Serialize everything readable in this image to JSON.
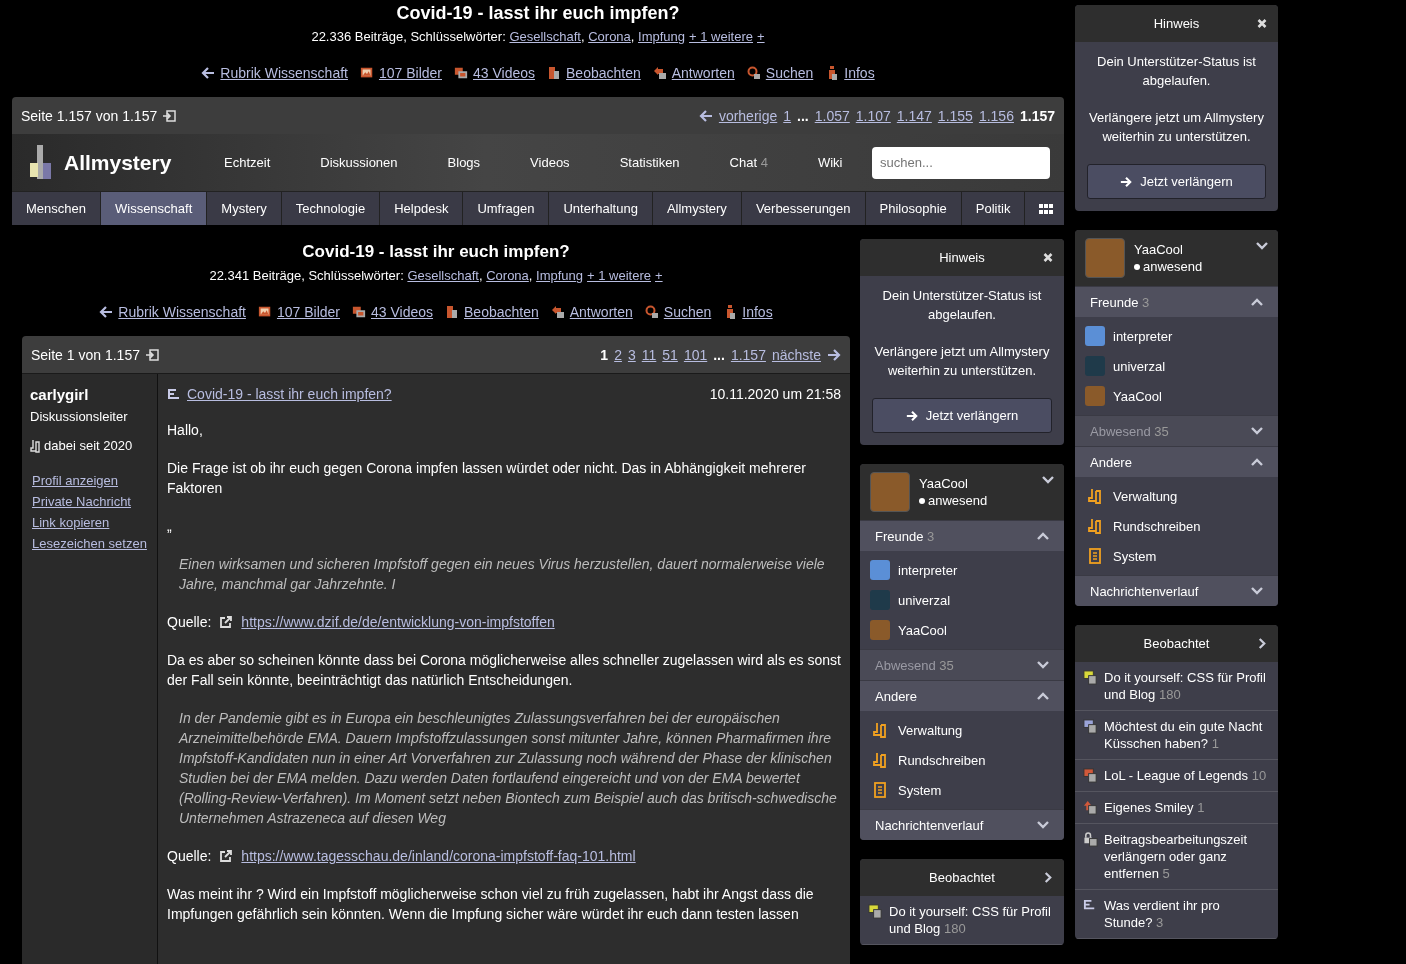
{
  "header": {
    "title": "Covid-19 - lasst ihr euch impfen?",
    "meta": [
      {
        "kind": "text",
        "text": "22.336 Beiträge, Schlüsselwörter: "
      },
      {
        "kind": "link",
        "text": "Gesellschaft"
      },
      {
        "kind": "text",
        "text": ", "
      },
      {
        "kind": "link",
        "text": "Corona"
      },
      {
        "kind": "text",
        "text": ", "
      },
      {
        "kind": "link",
        "text": "Impfung"
      },
      {
        "kind": "more",
        "text": "+ 1 weitere"
      },
      {
        "kind": "more",
        "text": "+"
      }
    ],
    "links": [
      {
        "kind": "back",
        "label": "Rubrik Wissenschaft"
      },
      {
        "kind": "images",
        "label": "107 Bilder"
      },
      {
        "kind": "videos",
        "label": "43 Videos"
      },
      {
        "kind": "watch",
        "label": "Beobachten"
      },
      {
        "kind": "reply",
        "label": "Antworten"
      },
      {
        "kind": "search",
        "label": "Suchen"
      },
      {
        "kind": "info",
        "label": "Infos"
      }
    ]
  },
  "pager_top": {
    "label": "Seite 1.157 von 1.157",
    "prev": "vorherige",
    "pages": [
      {
        "kind": "page",
        "label": "1",
        "selected": false
      },
      {
        "kind": "gap",
        "label": "..."
      },
      {
        "kind": "page",
        "label": "1.057",
        "selected": false
      },
      {
        "kind": "page",
        "label": "1.107",
        "selected": false
      },
      {
        "kind": "page",
        "label": "1.147",
        "selected": false
      },
      {
        "kind": "page",
        "label": "1.155",
        "selected": false
      },
      {
        "kind": "page",
        "label": "1.156",
        "selected": false
      },
      {
        "kind": "page",
        "label": "1.157",
        "selected": true
      }
    ]
  },
  "nav": {
    "logo": "Allmystery",
    "items": [
      {
        "label": "Echtzeit"
      },
      {
        "label": "Diskussionen"
      },
      {
        "label": "Blogs"
      },
      {
        "label": "Videos"
      },
      {
        "label": "Statistiken"
      },
      {
        "label": "Chat",
        "count": "4"
      },
      {
        "label": "Wiki"
      }
    ],
    "search": {
      "placeholder": "suchen..."
    }
  },
  "categories": [
    {
      "label": "Menschen",
      "selected": false
    },
    {
      "label": "Wissenschaft",
      "selected": true
    },
    {
      "label": "Mystery",
      "selected": false
    },
    {
      "label": "Technologie",
      "selected": false
    },
    {
      "label": "Helpdesk",
      "selected": false
    },
    {
      "label": "Umfragen",
      "selected": false
    },
    {
      "label": "Unterhaltung",
      "selected": false
    },
    {
      "label": "Allmystery",
      "selected": false
    },
    {
      "label": "Verbesserungen",
      "selected": false
    },
    {
      "label": "Philosophie",
      "selected": false
    },
    {
      "label": "Politik",
      "selected": false
    }
  ],
  "topic": {
    "title": "Covid-19 - lasst ihr euch impfen?",
    "meta": [
      {
        "kind": "text",
        "text": "22.341 Beiträge, Schlüsselwörter: "
      },
      {
        "kind": "link",
        "text": "Gesellschaft"
      },
      {
        "kind": "text",
        "text": ", "
      },
      {
        "kind": "link",
        "text": "Corona"
      },
      {
        "kind": "text",
        "text": ", "
      },
      {
        "kind": "link",
        "text": "Impfung"
      },
      {
        "kind": "more",
        "text": "+ 1 weitere"
      },
      {
        "kind": "more",
        "text": "+"
      }
    ],
    "links": [
      {
        "kind": "back",
        "label": "Rubrik Wissenschaft"
      },
      {
        "kind": "images",
        "label": "107 Bilder"
      },
      {
        "kind": "videos",
        "label": "43 Videos"
      },
      {
        "kind": "watch",
        "label": "Beobachten"
      },
      {
        "kind": "reply",
        "label": "Antworten"
      },
      {
        "kind": "search",
        "label": "Suchen"
      },
      {
        "kind": "info",
        "label": "Infos"
      }
    ]
  },
  "pager": {
    "label": "Seite 1 von 1.157",
    "next": "nächste",
    "pages": [
      {
        "kind": "page",
        "label": "1",
        "selected": true
      },
      {
        "kind": "page",
        "label": "2",
        "selected": false
      },
      {
        "kind": "page",
        "label": "3",
        "selected": false
      },
      {
        "kind": "page",
        "label": "11",
        "selected": false
      },
      {
        "kind": "page",
        "label": "51",
        "selected": false
      },
      {
        "kind": "page",
        "label": "101",
        "selected": false
      },
      {
        "kind": "gap",
        "label": "..."
      },
      {
        "kind": "page",
        "label": "1.157",
        "selected": false
      }
    ]
  },
  "post": {
    "author": "carlygirl",
    "role": "Diskussionsleiter",
    "since": "dabei seit 2020",
    "actions": [
      "Profil anzeigen",
      "Private Nachricht",
      "Link kopieren",
      "Lesezeichen setzen"
    ],
    "title": "Covid-19 - lasst ihr euch impfen?",
    "date": "10.11.2020 um 21:58",
    "blocks": [
      {
        "kind": "p",
        "text": "Hallo,"
      },
      {
        "kind": "p",
        "text": "Die Frage ist ob ihr euch gegen Corona impfen lassen würdet oder nicht. Das in Abhängigkeit mehrerer Faktoren"
      },
      {
        "kind": "p",
        "text": "„"
      },
      {
        "kind": "quote",
        "text": "Einen wirksamen und sicheren Impfstoff gegen ein neues Virus herzustellen, dauert normalerweise viele Jahre, manchmal gar Jahrzehnte. I"
      },
      {
        "kind": "source",
        "label": "Quelle:",
        "url": "https://www.dzif.de/de/entwicklung-von-impfstoffen"
      },
      {
        "kind": "p",
        "text": "Da es aber so scheinen könnte dass bei Corona möglicherweise alles schneller zugelassen wird als es sonst der Fall sein könnte, beeinträchtigt das natürlich Entscheidungen."
      },
      {
        "kind": "quote",
        "text": "In der Pandemie gibt es in Europa ein beschleunigtes Zulassungsverfahren bei der europäischen Arzneimittelbehörde EMA. Dauern Impfstoffzulassungen sonst mitunter Jahre, können Pharmafirmen ihre Impfstoff-Kandidaten nun in einer Art Vorverfahren zur Zulassung noch während der Phase der klinischen Studien bei der EMA melden. Dazu werden Daten fortlaufend eingereicht und von der EMA bewertet (Rolling-Review-Verfahren). Im Moment setzt neben Biontech zum Beispiel auch das britisch-schwedische Unternehmen Astrazeneca auf diesen Weg"
      },
      {
        "kind": "source",
        "label": "Quelle:",
        "url": "https://www.tagesschau.de/inland/corona-impfstoff-faq-101.html"
      },
      {
        "kind": "p",
        "text": "Was meint ihr ? Wird ein Impfstoff möglicherweise schon viel zu früh zugelassen, habt ihr Angst dass die Impfungen gefährlich sein könnten. Wenn die Impfung sicher wäre würdet ihr euch dann testen lassen"
      }
    ]
  },
  "sidebars": [
    {
      "notice": {
        "title": "Hinweis",
        "lines": [
          "Dein Unterstützer-Status ist abgelaufen.",
          "Verlängere jetzt um Allmystery weiterhin zu unterstützen."
        ],
        "button": "Jetzt verlängern"
      },
      "profile": {
        "name": "YaaCool",
        "status": "anwesend",
        "online": true
      },
      "sections": [
        {
          "title": "Freunde",
          "count": "3",
          "expanded": true,
          "dimmed": false,
          "items": [
            {
              "kind": "user",
              "label": "interpreter"
            },
            {
              "kind": "user",
              "label": "univerzal"
            },
            {
              "kind": "user",
              "label": "YaaCool"
            }
          ]
        },
        {
          "title": "Abwesend",
          "count": "35",
          "expanded": false,
          "dimmed": true
        },
        {
          "title": "Andere",
          "expanded": true,
          "dimmed": false,
          "items": [
            {
              "kind": "admin",
              "label": "Verwaltung"
            },
            {
              "kind": "admin",
              "label": "Rundschreiben"
            },
            {
              "kind": "doc",
              "label": "System"
            }
          ]
        },
        {
          "title": "Nachrichtenverlauf",
          "expanded": false,
          "dimmed": false
        }
      ],
      "watched": {
        "title": "Beobachtet",
        "items": [
          {
            "kind": "yellow",
            "title": "Do it yourself: CSS für Profil und Blog",
            "count": "180"
          }
        ]
      }
    },
    {
      "notice": {
        "title": "Hinweis",
        "lines": [
          "Dein Unterstützer-Status ist abgelaufen.",
          "Verlängere jetzt um Allmystery weiterhin zu unterstützen."
        ],
        "button": "Jetzt verlängern"
      },
      "profile": {
        "name": "YaaCool",
        "status": "anwesend",
        "online": true
      },
      "sections": [
        {
          "title": "Freunde",
          "count": "3",
          "expanded": true,
          "dimmed": false,
          "items": [
            {
              "kind": "user",
              "label": "interpreter"
            },
            {
              "kind": "user",
              "label": "univerzal"
            },
            {
              "kind": "user",
              "label": "YaaCool"
            }
          ]
        },
        {
          "title": "Abwesend",
          "count": "35",
          "expanded": false,
          "dimmed": true
        },
        {
          "title": "Andere",
          "expanded": true,
          "dimmed": false,
          "items": [
            {
              "kind": "admin",
              "label": "Verwaltung"
            },
            {
              "kind": "admin",
              "label": "Rundschreiben"
            },
            {
              "kind": "doc",
              "label": "System"
            }
          ]
        },
        {
          "title": "Nachrichtenverlauf",
          "expanded": false,
          "dimmed": false
        }
      ],
      "watched": {
        "title": "Beobachtet",
        "items": [
          {
            "kind": "yellow",
            "title": "Do it yourself: CSS für Profil und Blog",
            "count": "180"
          },
          {
            "kind": "blue",
            "title": "Möchtest du ein gute Nacht Küsschen haben?",
            "count": "1"
          },
          {
            "kind": "red",
            "title": "LoL - League of Legends",
            "count": "10"
          },
          {
            "kind": "pinned",
            "title": "Eigenes Smiley",
            "count": "1"
          },
          {
            "kind": "locked",
            "title": "Beitragsbearbeitungszeit verlängern oder ganz entfernen",
            "count": "5"
          },
          {
            "kind": "list",
            "title": "Was verdient ihr pro Stunde?",
            "count": "3"
          }
        ]
      }
    }
  ]
}
